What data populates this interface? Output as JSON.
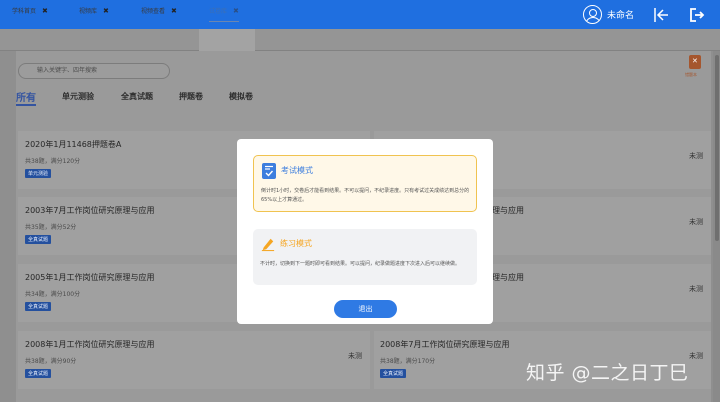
{
  "topbar": {
    "username": "未命名",
    "icons": [
      "user-avatar-icon",
      "collapse-left-icon",
      "logout-icon"
    ],
    "accent_color": "#1f6fe0"
  },
  "tabs": [
    {
      "label": "学科首页",
      "close": "✖"
    },
    {
      "label": "视频库",
      "close": "✖"
    },
    {
      "label": "视频查看",
      "close": "✖"
    },
    {
      "label": "试卷库",
      "close": "✖",
      "active": true
    }
  ],
  "search": {
    "placeholder": "输入关键字、四年搜索"
  },
  "categories": [
    "所有",
    "单元测验",
    "全真试题",
    "押题卷",
    "模拟卷"
  ],
  "corner_badge": {
    "label": "错题本"
  },
  "papers": [
    {
      "title": "2020年1月11468押题卷A",
      "meta": "共38题，满分120分",
      "tag": "单元测验",
      "status": "未测"
    },
    {
      "title": "",
      "meta": "",
      "tag": "",
      "status": "未测"
    },
    {
      "title": "2003年7月工作岗位研究原理与应用",
      "meta": "共35题，满分52分",
      "tag": "全真试题",
      "status": ""
    },
    {
      "title": "理与应用",
      "meta": "",
      "tag": "",
      "status": "未测"
    },
    {
      "title": "2005年1月工作岗位研究原理与应用",
      "meta": "共34题，满分100分",
      "tag": "全真试题",
      "status": ""
    },
    {
      "title": "理与应用",
      "meta": "",
      "tag": "",
      "status": "未测"
    },
    {
      "title": "2008年1月工作岗位研究原理与应用",
      "meta": "共38题，满分90分",
      "tag": "全真试题",
      "status": "未测"
    },
    {
      "title": "2008年7月工作岗位研究原理与应用",
      "meta": "共38题，满分170分",
      "tag": "全真试题",
      "status": "未测"
    }
  ],
  "modal": {
    "exam_title": "考试模式",
    "exam_desc": "倒计时1小时，交卷后才能看到结果。不可以提问，不纪录进度。只有考试过关成绩达到总分的65%以上才算通过。",
    "practice_title": "练习模式",
    "practice_desc": "不计时，切换到下一题时即可看到结果。可以提问，纪录做题进度下次进入后可以继续做。",
    "exit_label": "退出"
  },
  "watermark": "知乎 @二之日丁巳"
}
